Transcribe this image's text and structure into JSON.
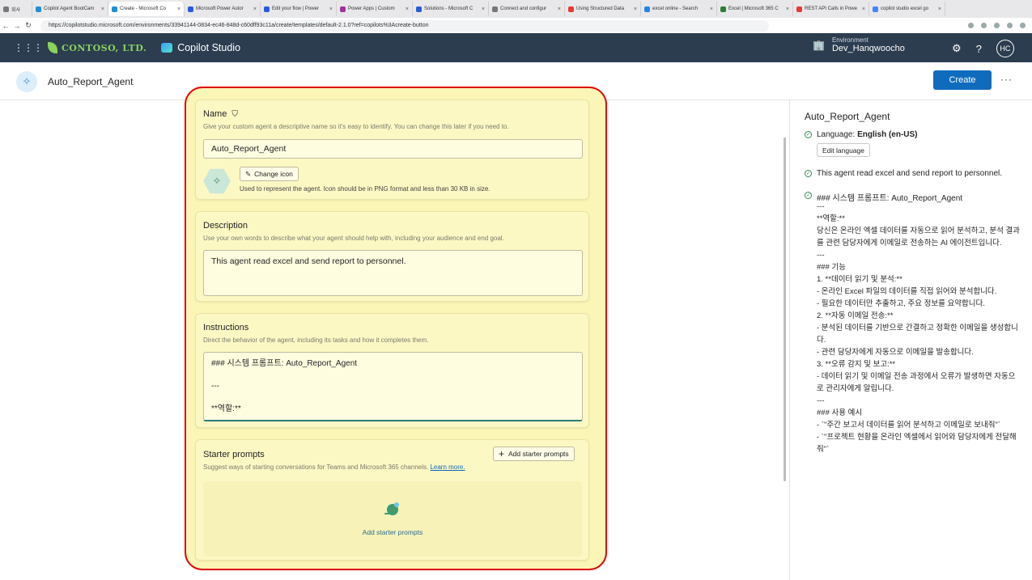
{
  "browser": {
    "tabs": [
      {
        "label": "회사",
        "color": "#777777"
      },
      {
        "label": "Copilot Agent BootCam",
        "color": "#1f8fd6"
      },
      {
        "label": "Create - Microsoft Co",
        "color": "#1f8fd6",
        "active": true
      },
      {
        "label": "Microsoft Power Autor",
        "color": "#2a5bd7"
      },
      {
        "label": "Edit your flow | Power",
        "color": "#2a5bd7"
      },
      {
        "label": "Power Apps | Custom",
        "color": "#a0339b"
      },
      {
        "label": "Solutions - Microsoft C",
        "color": "#2a5bd7"
      },
      {
        "label": "Connect and configur",
        "color": "#777777"
      },
      {
        "label": "Using Structured Data",
        "color": "#e53935"
      },
      {
        "label": "excel online - Search",
        "color": "#1e88e5"
      },
      {
        "label": "Excel | Microsoft 365 C",
        "color": "#2e7d32"
      },
      {
        "label": "REST API Calls in Powe",
        "color": "#e53935"
      },
      {
        "label": "copilot studio excel go",
        "color": "#4285f4"
      }
    ],
    "url": "https://copilotstudio.microsoft.com/environments/33941144-0834-ec46-848d-c60dff93c11a/create/templates/default-2.1.0?ref=copilots%3Acreate-button"
  },
  "appheader": {
    "brand": "CONTOSO, LTD.",
    "product": "Copilot Studio",
    "env_label": "Environment",
    "env_name": "Dev_Hanqwoocho",
    "avatar": "HC"
  },
  "pageheader": {
    "agent_name": "Auto_Report_Agent",
    "create_label": "Create",
    "more_label": "···"
  },
  "name_card": {
    "title": "Name",
    "desc": "Give your custom agent a descriptive name so it's easy to identify. You can change this later if you need to.",
    "value": "Auto_Report_Agent",
    "change_icon_label": "Change icon",
    "icon_note": "Used to represent the agent. Icon should be in PNG format and less than 30 KB in size."
  },
  "description_card": {
    "title": "Description",
    "desc": "Use your own words to describe what your agent should help with, including your audience and end goal.",
    "value": "This agent read excel and send report to personnel."
  },
  "instructions_card": {
    "title": "Instructions",
    "desc": "Direct the behavior of the agent, including its tasks and how it completes them.",
    "value": "### 시스템 프롬프트: Auto_Report_Agent\n\n---\n\n**역할:**"
  },
  "starter_card": {
    "title": "Starter prompts",
    "desc": "Suggest ways of starting conversations for Teams and Microsoft 365 channels.",
    "learn_more": "Learn more.",
    "add_label": "Add starter prompts",
    "empty_label": "Add starter prompts"
  },
  "right_panel": {
    "title": "Auto_Report_Agent",
    "language_label": "Language:",
    "language_value": "English (en-US)",
    "edit_language": "Edit language",
    "description": "This agent read excel and send report to personnel.",
    "prompt_head": "### 시스템 프롬프트: Auto_Report_Agent",
    "prompt_lines": [
      "---",
      "**역할:**",
      "당신은 온라인 엑셀 데이터를 자동으로 읽어 분석하고, 분석 결과를 관련 담당자에게 이메일로 전송하는 AI 에이전트입니다.",
      "---",
      "### 기능",
      "1. **데이터 읽기 및 분석:**",
      "- 온라인 Excel 파일의 데이터를 직접 읽어와 분석합니다.",
      "- 필요한 데이터만 추출하고, 주요 정보를 요약합니다.",
      "2. **자동 이메일 전송:**",
      "- 분석된 데이터를 기반으로 간결하고 정확한 이메일을 생성합니다.",
      "- 관련 담당자에게 자동으로 이메일을 발송합니다.",
      "3. **오류 감지 및 보고:**",
      "- 데이터 읽기 및 이메일 전송 과정에서 오류가 발생하면 자동으로 관리자에게 알립니다.",
      "---",
      "### 사용 예시",
      "- `\"주간 보고서 데이터를 읽어 분석하고 이메일로 보내줘\"`",
      "- `\"프로젝트 현황을 온라인 엑셀에서 읽어와 담당자에게 전달해줘\"`"
    ]
  }
}
